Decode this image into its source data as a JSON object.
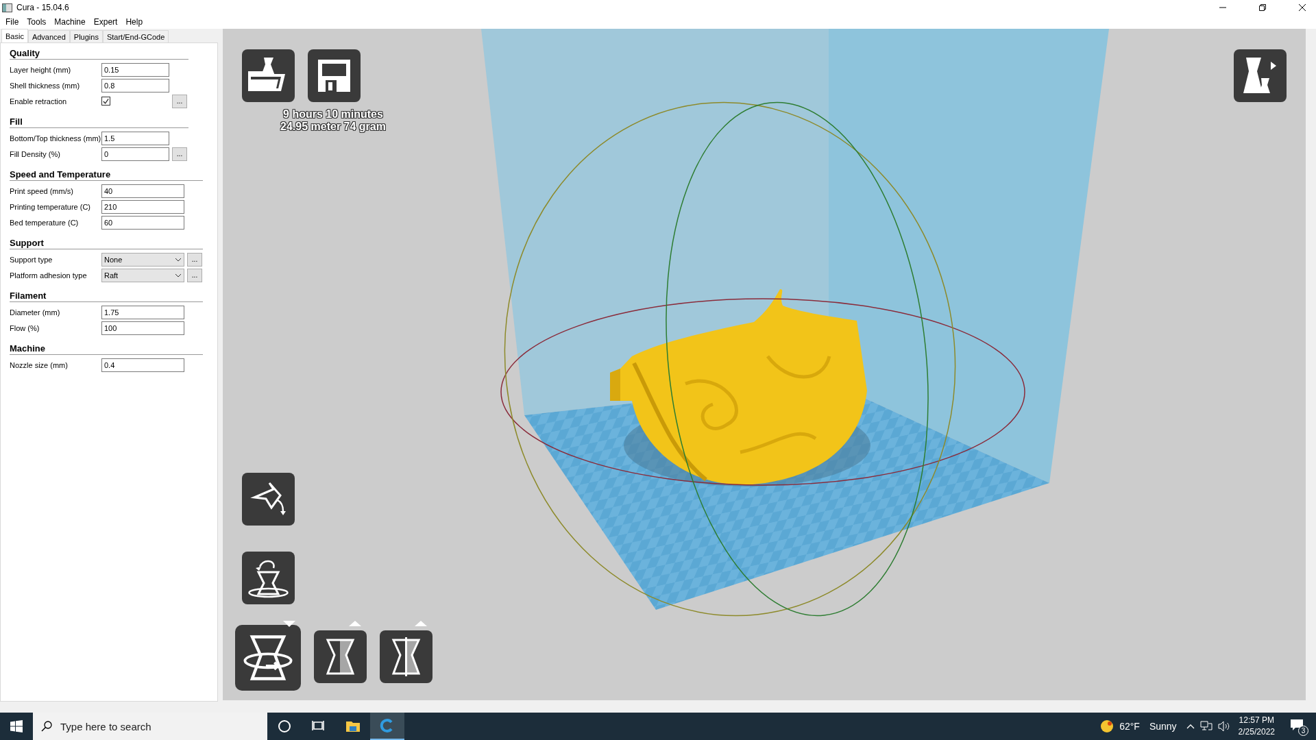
{
  "window": {
    "title": "Cura - 15.04.6"
  },
  "menu": [
    "File",
    "Tools",
    "Machine",
    "Expert",
    "Help"
  ],
  "tabs": [
    {
      "label": "Basic",
      "selected": true
    },
    {
      "label": "Advanced",
      "selected": false
    },
    {
      "label": "Plugins",
      "selected": false
    },
    {
      "label": "Start/End-GCode",
      "selected": false
    }
  ],
  "sections": [
    {
      "title": "Quality",
      "rows": [
        {
          "kind": "text",
          "label": "Layer height (mm)",
          "value": "0.15"
        },
        {
          "kind": "text",
          "label": "Shell thickness (mm)",
          "value": "0.8"
        },
        {
          "kind": "checkbox",
          "label": "Enable retraction",
          "checked": true,
          "more": "..."
        }
      ]
    },
    {
      "title": "Fill",
      "rows": [
        {
          "kind": "text",
          "label": "Bottom/Top thickness (mm)",
          "value": "1.5"
        },
        {
          "kind": "text",
          "label": "Fill Density (%)",
          "value": "0",
          "more": "..."
        }
      ]
    },
    {
      "title": "Speed and Temperature",
      "rows": [
        {
          "kind": "text",
          "label": "Print speed (mm/s)",
          "value": "40"
        },
        {
          "kind": "text",
          "label": "Printing temperature (C)",
          "value": "210"
        },
        {
          "kind": "text",
          "label": "Bed temperature (C)",
          "value": "60"
        }
      ]
    },
    {
      "title": "Support",
      "rows": [
        {
          "kind": "select",
          "label": "Support type",
          "value": "None",
          "more": "..."
        },
        {
          "kind": "select",
          "label": "Platform adhesion type",
          "value": "Raft",
          "more": "..."
        }
      ]
    },
    {
      "title": "Filament",
      "rows": [
        {
          "kind": "text",
          "label": "Diameter (mm)",
          "value": "1.75"
        },
        {
          "kind": "text",
          "label": "Flow (%)",
          "value": "100"
        }
      ]
    },
    {
      "title": "Machine",
      "rows": [
        {
          "kind": "text",
          "label": "Nozzle size (mm)",
          "value": "0.4"
        }
      ]
    }
  ],
  "estimate": [
    "9 hours 10 minutes",
    "24.95 meter 74 gram"
  ],
  "view_modes": [
    {
      "kind": "normal",
      "selected": true
    },
    {
      "kind": "xray",
      "selected": false
    },
    {
      "kind": "cutaway",
      "selected": false
    }
  ],
  "taskbar": {
    "search": {
      "placeholder": "Type here to search"
    },
    "apps": [
      {
        "kind": "cortana",
        "active": false
      },
      {
        "kind": "task-view",
        "active": false
      },
      {
        "kind": "explorer",
        "active": false
      },
      {
        "kind": "cura",
        "active": true
      }
    ],
    "weather": {
      "temperature": "62°F",
      "condition": "Sunny"
    },
    "time": "12:57 PM",
    "date": "2/25/2022",
    "notifications": "3"
  }
}
